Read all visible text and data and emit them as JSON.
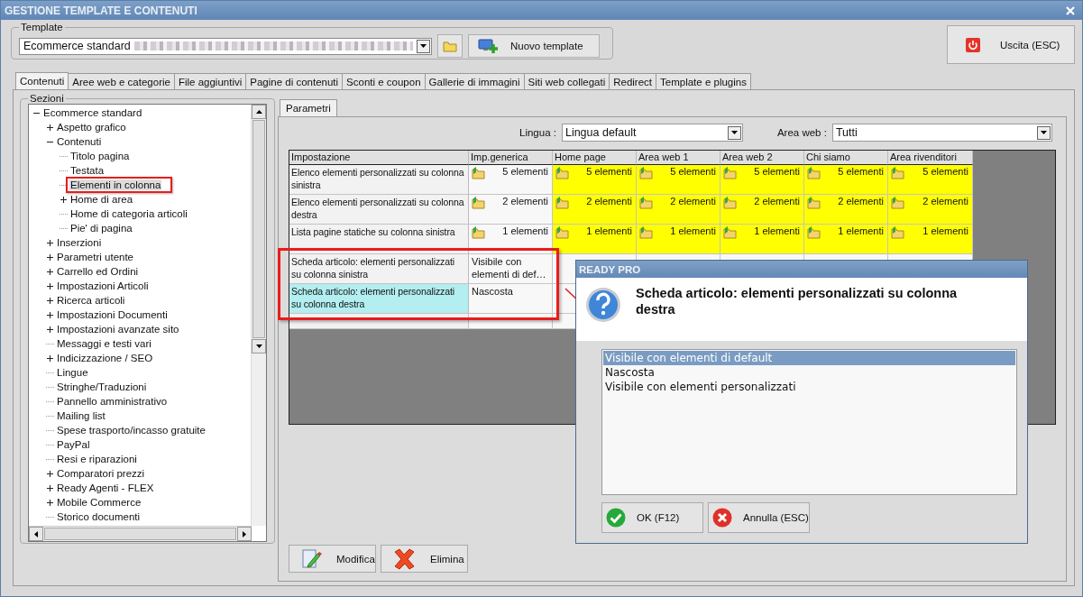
{
  "window": {
    "title": "GESTIONE TEMPLATE E CONTENUTI"
  },
  "template": {
    "label": "Template",
    "value": "Ecommerce standard",
    "new_button": "Nuovo template"
  },
  "exit_button": "Uscita (ESC)",
  "tabs": [
    {
      "label": "Contenuti",
      "selected": true
    },
    {
      "label": "Aree web e categorie",
      "selected": false
    },
    {
      "label": "File aggiuntivi",
      "selected": false
    },
    {
      "label": "Pagine di contenuti",
      "selected": false
    },
    {
      "label": "Sconti e coupon",
      "selected": false
    },
    {
      "label": "Gallerie di immagini",
      "selected": false
    },
    {
      "label": "Siti web collegati",
      "selected": false
    },
    {
      "label": "Redirect",
      "selected": false
    },
    {
      "label": "Template e plugins",
      "selected": false
    }
  ],
  "sections": {
    "label": "Sezioni",
    "tree": [
      {
        "label": "Ecommerce standard",
        "kind": "node",
        "expanded": true,
        "selected": false,
        "children": [
          {
            "label": "Aspetto grafico",
            "kind": "node",
            "expanded": false,
            "selected": false
          },
          {
            "label": "Contenuti",
            "kind": "node",
            "expanded": true,
            "selected": false,
            "children": [
              {
                "label": "Titolo pagina",
                "kind": "leaf",
                "selected": false
              },
              {
                "label": "Testata",
                "kind": "leaf",
                "selected": false
              },
              {
                "label": "Elementi in colonna",
                "kind": "leaf",
                "selected": true
              },
              {
                "label": "Home di area",
                "kind": "node",
                "expanded": false,
                "selected": false
              },
              {
                "label": "Home di categoria articoli",
                "kind": "leaf",
                "selected": false
              },
              {
                "label": "Pie' di pagina",
                "kind": "leaf",
                "selected": false
              }
            ]
          },
          {
            "label": "Inserzioni",
            "kind": "node",
            "expanded": false,
            "selected": false
          },
          {
            "label": "Parametri utente",
            "kind": "node",
            "expanded": false,
            "selected": false
          },
          {
            "label": "Carrello ed Ordini",
            "kind": "node",
            "expanded": false,
            "selected": false
          },
          {
            "label": "Impostazioni Articoli",
            "kind": "node",
            "expanded": false,
            "selected": false
          },
          {
            "label": "Ricerca articoli",
            "kind": "node",
            "expanded": false,
            "selected": false
          },
          {
            "label": "Impostazioni Documenti",
            "kind": "node",
            "expanded": false,
            "selected": false
          },
          {
            "label": "Impostazioni avanzate sito",
            "kind": "node",
            "expanded": false,
            "selected": false
          },
          {
            "label": "Messaggi e testi vari",
            "kind": "leaf",
            "selected": false
          },
          {
            "label": "Indicizzazione / SEO",
            "kind": "node",
            "expanded": false,
            "selected": false
          },
          {
            "label": "Lingue",
            "kind": "leaf",
            "selected": false
          },
          {
            "label": "Stringhe/Traduzioni",
            "kind": "leaf",
            "selected": false
          },
          {
            "label": "Pannello amministrativo",
            "kind": "leaf",
            "selected": false
          },
          {
            "label": "Mailing list",
            "kind": "leaf",
            "selected": false
          },
          {
            "label": "Spese trasporto/incasso gratuite",
            "kind": "leaf",
            "selected": false
          },
          {
            "label": "PayPal",
            "kind": "leaf",
            "selected": false
          },
          {
            "label": "Resi e riparazioni",
            "kind": "leaf",
            "selected": false
          },
          {
            "label": "Comparatori prezzi",
            "kind": "node",
            "expanded": false,
            "selected": false
          },
          {
            "label": "Ready Agenti - FLEX",
            "kind": "node",
            "expanded": false,
            "selected": false
          },
          {
            "label": "Mobile Commerce",
            "kind": "node",
            "expanded": false,
            "selected": false
          },
          {
            "label": "Storico documenti",
            "kind": "leaf",
            "selected": false
          }
        ]
      }
    ]
  },
  "parameters": {
    "tab": "Parametri",
    "language": {
      "label": "Lingua :",
      "value": "Lingua default"
    },
    "area": {
      "label": "Area web :",
      "value": "Tutti"
    },
    "columns": [
      "Impostazione",
      "Imp.generica",
      "Home page",
      "Area web 1",
      "Area web 2",
      "Chi siamo",
      "Area rivenditori"
    ],
    "rows": [
      {
        "setting": "Elenco elementi personalizzati su colonna sinistra",
        "selected": false,
        "boxed": false,
        "cells": [
          {
            "kind": "list",
            "text": "5 elementi",
            "highlighted": false
          },
          {
            "kind": "list",
            "text": "5 elementi",
            "highlighted": true
          },
          {
            "kind": "list",
            "text": "5 elementi",
            "highlighted": true
          },
          {
            "kind": "list",
            "text": "5 elementi",
            "highlighted": true
          },
          {
            "kind": "list",
            "text": "5 elementi",
            "highlighted": true
          },
          {
            "kind": "list",
            "text": "5 elementi",
            "highlighted": true
          }
        ]
      },
      {
        "setting": "Elenco elementi personalizzati su colonna destra",
        "selected": false,
        "boxed": false,
        "cells": [
          {
            "kind": "list",
            "text": "2 elementi",
            "highlighted": false
          },
          {
            "kind": "list",
            "text": "2 elementi",
            "highlighted": true
          },
          {
            "kind": "list",
            "text": "2 elementi",
            "highlighted": true
          },
          {
            "kind": "list",
            "text": "2 elementi",
            "highlighted": true
          },
          {
            "kind": "list",
            "text": "2 elementi",
            "highlighted": true
          },
          {
            "kind": "list",
            "text": "2 elementi",
            "highlighted": true
          }
        ]
      },
      {
        "setting": "Lista pagine statiche su colonna sinistra",
        "selected": false,
        "boxed": false,
        "cells": [
          {
            "kind": "list",
            "text": "1 elementi",
            "highlighted": false
          },
          {
            "kind": "list",
            "text": "1 elementi",
            "highlighted": true
          },
          {
            "kind": "list",
            "text": "1 elementi",
            "highlighted": true
          },
          {
            "kind": "list",
            "text": "1 elementi",
            "highlighted": true
          },
          {
            "kind": "list",
            "text": "1 elementi",
            "highlighted": true
          },
          {
            "kind": "list",
            "text": "1 elementi",
            "highlighted": true
          }
        ]
      },
      {
        "setting": "Scheda articolo: elementi personalizzati su colonna sinistra",
        "selected": false,
        "boxed": true,
        "cells": [
          {
            "kind": "text",
            "text": "Visibile con elementi di def…",
            "highlighted": false
          }
        ]
      },
      {
        "setting": "Scheda articolo: elementi personalizzati su colonna destra",
        "selected": true,
        "boxed": true,
        "cells": [
          {
            "kind": "text",
            "text": "Nascosta",
            "highlighted": false
          }
        ]
      }
    ],
    "buttons": [
      {
        "kind": "edit",
        "label": "Modifica"
      },
      {
        "kind": "delete",
        "label": "Elimina"
      }
    ]
  },
  "dialog": {
    "title": "READY PRO",
    "question": "Scheda articolo: elementi personalizzati su colonna destra",
    "options": [
      {
        "label": "Visibile con elementi di default",
        "selected": true
      },
      {
        "label": "Nascosta",
        "selected": false
      },
      {
        "label": "Visibile con elementi personalizzati",
        "selected": false
      }
    ],
    "buttons": [
      {
        "kind": "ok",
        "label": "OK (F12)"
      },
      {
        "kind": "cancel",
        "label": "Annulla (ESC)"
      }
    ]
  }
}
